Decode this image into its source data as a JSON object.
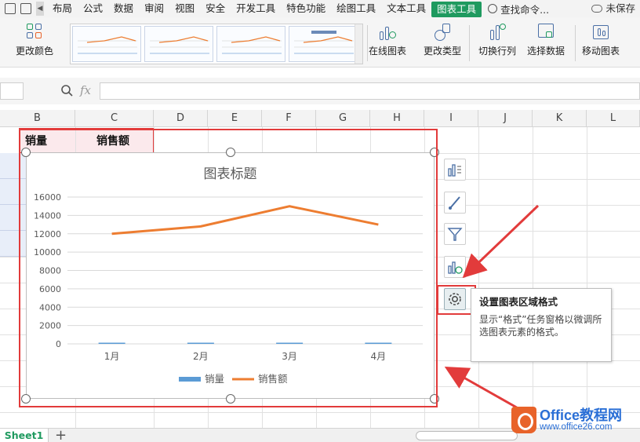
{
  "menubar": {
    "items": [
      "布局",
      "公式",
      "数据",
      "审阅",
      "视图",
      "安全",
      "开发工具",
      "特色功能",
      "绘图工具",
      "文本工具",
      "图表工具"
    ],
    "active_index": 10,
    "search_label": "查找命令...",
    "unsaved_label": "未保存"
  },
  "ribbon": {
    "change_color": "更改颜色",
    "online_chart": "在线图表",
    "change_type": "更改类型",
    "switch_row_col": "切换行列",
    "select_data": "选择数据",
    "move_chart": "移动图表"
  },
  "formula_bar": {
    "fx_label": "fx"
  },
  "columns": [
    "B",
    "C",
    "D",
    "E",
    "F",
    "G",
    "H",
    "I",
    "J",
    "K",
    "L"
  ],
  "cells": {
    "header_sales_qty": "销量",
    "header_sales_amt": "销售额"
  },
  "tooltip": {
    "title": "设置图表区域格式",
    "body": "显示“格式”任务窗格以微调所选图表元素的格式。"
  },
  "sheet": {
    "tab_label": "Sheet1",
    "add_label": "+"
  },
  "watermark": {
    "brand": "Office教程网",
    "url": "www.office26.com"
  },
  "colors": {
    "accent": "#1f9a5f",
    "highlight": "#e23b3b",
    "series1": "#5b9bd5",
    "series2": "#ed7d31"
  },
  "chart_data": {
    "type": "line",
    "title": "图表标题",
    "categories": [
      "1月",
      "2月",
      "3月",
      "4月"
    ],
    "series": [
      {
        "name": "销量",
        "values": [
          50,
          60,
          65,
          60
        ],
        "kind": "bar"
      },
      {
        "name": "销售额",
        "values": [
          12000,
          12800,
          15000,
          13000
        ],
        "kind": "line"
      }
    ],
    "ylim": [
      0,
      16000
    ],
    "yticks": [
      "0",
      "2000",
      "4000",
      "6000",
      "8000",
      "10000",
      "12000",
      "14000",
      "16000"
    ],
    "grid": true,
    "legend": "bottom"
  }
}
